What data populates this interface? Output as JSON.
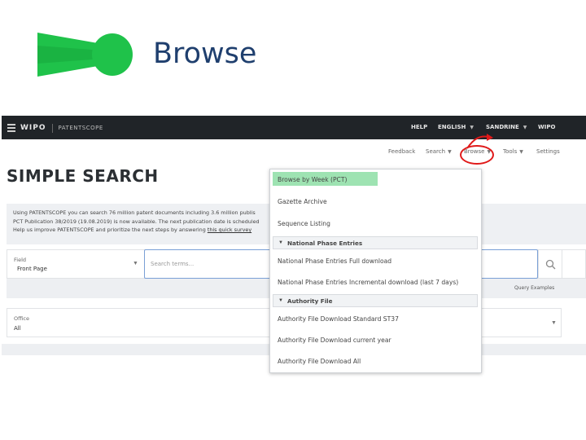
{
  "slide": {
    "title": "Browse",
    "colors": {
      "title": "#1f3f6e",
      "logo_green": "#1fc24a"
    }
  },
  "topbar": {
    "brand": "WIPO",
    "product": "PATENTSCOPE",
    "nav": {
      "help": "HELP",
      "language": "ENGLISH",
      "user": "SANDRINE",
      "wipo": "WIPO"
    }
  },
  "subnav": {
    "feedback": "Feedback",
    "search": "Search",
    "browse": "Browse",
    "tools": "Tools",
    "settings": "Settings"
  },
  "page": {
    "title": "SIMPLE SEARCH",
    "info": {
      "line1": "Using PATENTSCOPE you can search 76 million patent documents including 3.6 million publis",
      "line2": "PCT Publication 38/2019 (19.08.2019) is now available. The next publication date is scheduled",
      "line3_prefix": "Help us improve PATENTSCOPE and prioritize the next steps by answering ",
      "line3_link": "this quick survey"
    },
    "field": {
      "label": "Field",
      "value": "Front Page"
    },
    "search": {
      "placeholder": "Search terms..."
    },
    "query_examples": "Query Examples",
    "office": {
      "label": "Office",
      "value": "All"
    }
  },
  "dropdown": {
    "items": {
      "browse_by_week": "Browse by Week (PCT)",
      "gazette_archive": "Gazette Archive",
      "sequence_listing": "Sequence Listing",
      "national_phase_section": "National Phase Entries",
      "npe_full": "National Phase Entries Full download",
      "npe_incremental": "National Phase Entries Incremental download (last 7 days)",
      "authority_section": "Authority File",
      "af_standard": "Authority File Download Standard ST37",
      "af_current": "Authority File Download current year",
      "af_all": "Authority File Download All"
    },
    "highlight_color": "#9ee3b2"
  },
  "annotation": {
    "color": "#e01919"
  }
}
